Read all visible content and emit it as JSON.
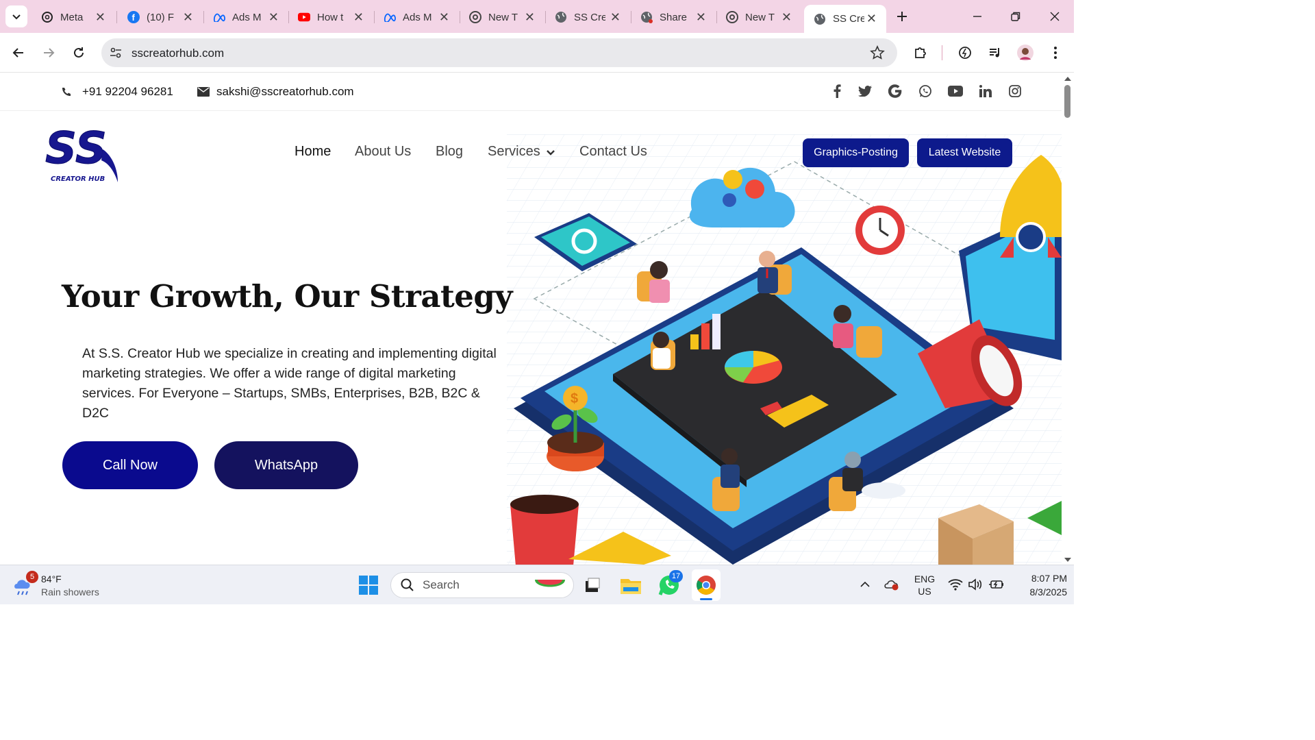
{
  "browser": {
    "tabs": [
      {
        "title": "Meta",
        "icon": "threads-icon"
      },
      {
        "title": "(10) F",
        "icon": "facebook-icon"
      },
      {
        "title": "Ads M",
        "icon": "meta-icon"
      },
      {
        "title": "How t",
        "icon": "youtube-icon"
      },
      {
        "title": "Ads M",
        "icon": "meta-icon"
      },
      {
        "title": "New T",
        "icon": "chrome-icon"
      },
      {
        "title": "SS Cre",
        "icon": "globe-icon"
      },
      {
        "title": "Share",
        "icon": "globe-icon"
      },
      {
        "title": "New T",
        "icon": "chrome-icon"
      },
      {
        "title": "SS Cre",
        "icon": "globe-icon",
        "active": true
      }
    ],
    "url": "sscreatorhub.com"
  },
  "site": {
    "phone": "+91 92204 96281",
    "email": "sakshi@sscreatorhub.com",
    "socials": [
      "facebook-icon",
      "twitter-icon",
      "google-icon",
      "whatsapp-icon",
      "youtube-icon",
      "linkedin-icon",
      "instagram-icon"
    ],
    "logo_text": "SS",
    "logo_sub": "CREATOR HUB",
    "nav": [
      "Home",
      "About Us",
      "Blog",
      "Services",
      "Contact Us"
    ],
    "buttons": {
      "graphics": "Graphics-Posting",
      "latest": "Latest Website"
    },
    "hero": {
      "title": "Your Growth, Our Strategy",
      "description": "At S.S. Creator Hub we specialize in creating and implementing digital marketing strategies. We offer a wide range of digital marketing services. For Everyone – Startups, SMBs, Enterprises, B2B, B2C & D2C",
      "call": "Call Now",
      "whatsapp": "WhatsApp"
    },
    "colors": {
      "primary": "#0d1a8c",
      "cta_call": "#0a0a8e",
      "cta_whatsapp": "#14125e"
    }
  },
  "taskbar": {
    "weather_temp": "84°F",
    "weather_desc": "Rain showers",
    "weather_badge": "5",
    "search": "Search",
    "whatsapp_badge": "17",
    "lang1": "ENG",
    "lang2": "US",
    "time": "8:07 PM",
    "date": "8/3/2025"
  }
}
